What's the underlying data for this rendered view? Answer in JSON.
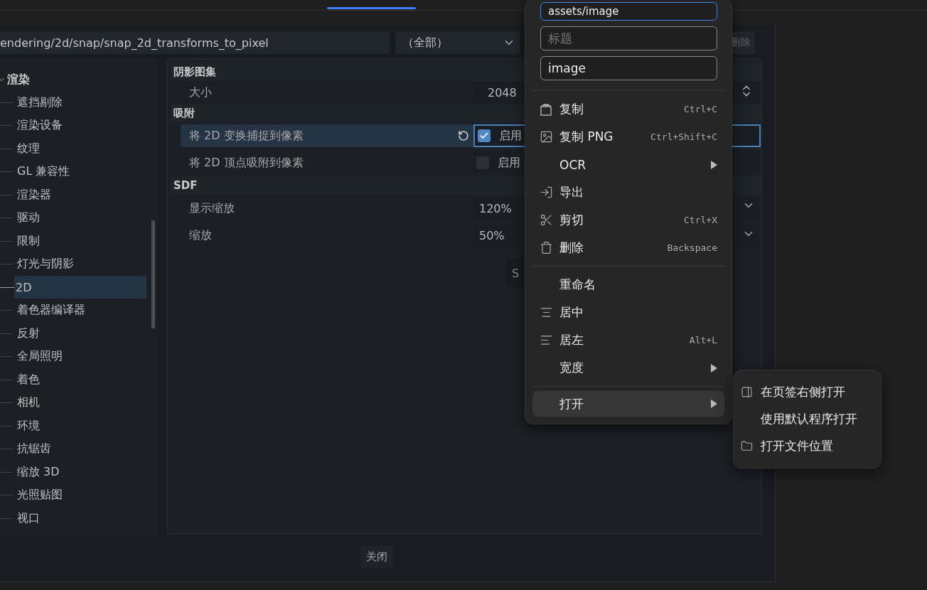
{
  "dialog": {
    "path_field": {
      "value": "endering/2d/snap/snap_2d_transforms_to_pixel"
    },
    "filter_select": {
      "value": "（全部）"
    },
    "delete_button": "删除",
    "tree": [
      {
        "label": "渲染",
        "expanded": true,
        "children": [
          {
            "label": "遮挡剔除",
            "selected": false
          },
          {
            "label": "渲染设备",
            "selected": false
          },
          {
            "label": "纹理",
            "selected": false
          },
          {
            "label": "GL 兼容性",
            "selected": false
          },
          {
            "label": "渲染器",
            "selected": false
          },
          {
            "label": "驱动",
            "selected": false
          },
          {
            "label": "限制",
            "selected": false
          },
          {
            "label": "灯光与阴影",
            "selected": false
          },
          {
            "label": "2D",
            "selected": true
          },
          {
            "label": "着色器编译器",
            "selected": false
          },
          {
            "label": "反射",
            "selected": false
          },
          {
            "label": "全局照明",
            "selected": false
          },
          {
            "label": "着色",
            "selected": false
          },
          {
            "label": "相机",
            "selected": false
          },
          {
            "label": "环境",
            "selected": false
          },
          {
            "label": "抗锯齿",
            "selected": false
          },
          {
            "label": "缩放 3D",
            "selected": false
          },
          {
            "label": "光照贴图",
            "selected": false
          },
          {
            "label": "视口",
            "selected": false
          }
        ]
      }
    ],
    "sections": [
      {
        "title": "阴影图集",
        "rows": [
          {
            "kind": "number",
            "label": "大小",
            "value": "2048",
            "selected": false
          }
        ]
      },
      {
        "title": "吸附",
        "rows": [
          {
            "kind": "checkbox",
            "label": "将 2D 变换捕捉到像素",
            "checked": true,
            "text": "启用",
            "selected": true,
            "revert": true
          },
          {
            "kind": "checkbox",
            "label": "将 2D 顶点吸附到像素",
            "checked": false,
            "text": "启用",
            "selected": false,
            "revert": false
          }
        ]
      },
      {
        "title": "SDF",
        "rows": [
          {
            "kind": "select",
            "label": "显示缩放",
            "value": "120%",
            "selected": false
          },
          {
            "kind": "select",
            "label": "缩放",
            "value": "50%",
            "selected": false
          }
        ]
      }
    ],
    "hidden_button": "S",
    "close_button": "关闭"
  },
  "context_menu": {
    "fields": [
      {
        "value": "assets/image",
        "focused": true
      },
      {
        "placeholder": "标题",
        "focused": false
      },
      {
        "value": "image",
        "focused": false
      }
    ],
    "groups": [
      [
        {
          "label": "复制",
          "shortcut": "Ctrl+C",
          "submenu": false,
          "highlighted": false
        },
        {
          "label": "复制 PNG",
          "shortcut": "Ctrl+Shift+C",
          "submenu": false,
          "highlighted": false
        },
        {
          "label": "OCR",
          "submenu": true,
          "highlighted": false
        },
        {
          "label": "导出",
          "submenu": false,
          "highlighted": false
        },
        {
          "label": "剪切",
          "shortcut": "Ctrl+X",
          "submenu": false,
          "highlighted": false
        },
        {
          "label": "删除",
          "shortcut": "Backspace",
          "submenu": false,
          "highlighted": false
        }
      ],
      [
        {
          "label": "重命名",
          "submenu": false,
          "highlighted": false
        },
        {
          "label": "居中",
          "submenu": false,
          "highlighted": false
        },
        {
          "label": "居左",
          "shortcut": "Alt+L",
          "submenu": false,
          "highlighted": false
        },
        {
          "label": "宽度",
          "submenu": true,
          "highlighted": false
        }
      ],
      [
        {
          "label": "打开",
          "submenu": true,
          "highlighted": true
        }
      ]
    ]
  },
  "submenu": {
    "items": [
      {
        "label": "在页签右侧打开"
      },
      {
        "label": "使用默认程序打开"
      },
      {
        "label": "打开文件位置"
      }
    ]
  }
}
